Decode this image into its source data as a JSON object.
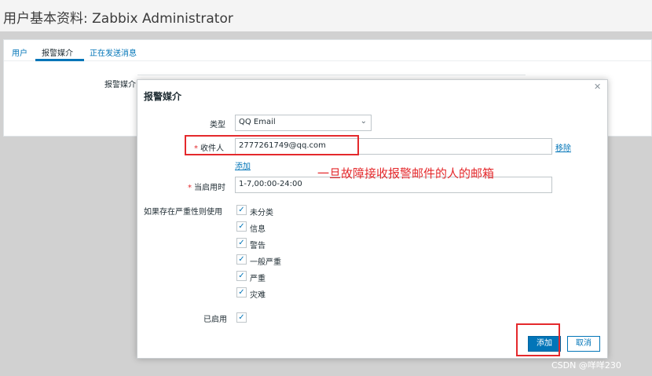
{
  "page": {
    "title": "用户基本资料: Zabbix Administrator"
  },
  "tabs": [
    {
      "label": "用户"
    },
    {
      "label": "报警媒介"
    },
    {
      "label": "正在发送消息"
    }
  ],
  "media_section_label": "报警媒介",
  "dialog": {
    "title": "报警媒介",
    "type_label": "类型",
    "type_value": "QQ Email",
    "recipient_label": "收件人",
    "recipient_value": "2777261749@qq.com",
    "remove_link": "移除",
    "add_link": "添加",
    "when_active_label": "当启用时",
    "when_active_value": "1-7,00:00-24:00",
    "severity_label": "如果存在严重性则使用",
    "severities": [
      {
        "label": "未分类",
        "checked": true
      },
      {
        "label": "信息",
        "checked": true
      },
      {
        "label": "警告",
        "checked": true
      },
      {
        "label": "一般严重",
        "checked": true
      },
      {
        "label": "严重",
        "checked": true
      },
      {
        "label": "灾难",
        "checked": true
      }
    ],
    "enabled_label": "已启用",
    "enabled_checked": true,
    "add_button": "添加",
    "cancel_button": "取消"
  },
  "annotation": "一旦故障接收报警邮件的人的邮箱",
  "watermark": "CSDN @咩咩230",
  "colors": {
    "accent": "#0275b8",
    "annotation_red": "#e4292c",
    "backdrop": "#d1d1d1"
  }
}
